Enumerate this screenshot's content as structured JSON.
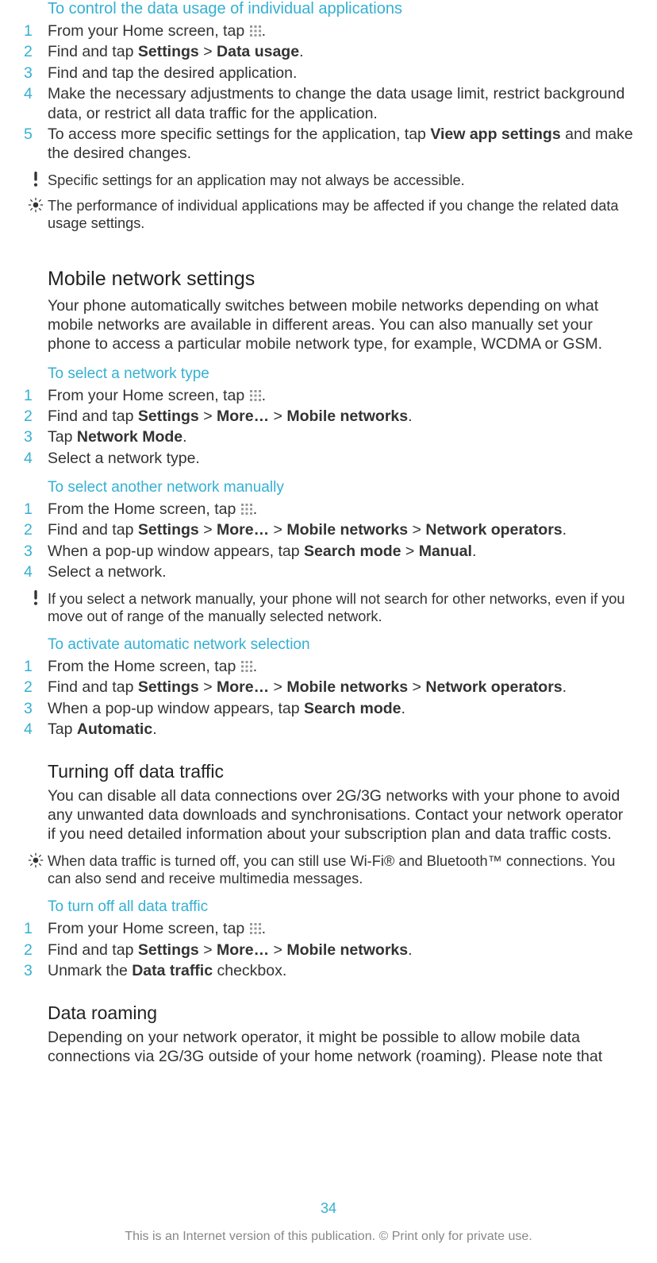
{
  "section1": {
    "heading": "To control the data usage of individual applications",
    "steps": [
      {
        "num": "1",
        "pre": "From your Home screen, tap ",
        "post": "."
      },
      {
        "num": "2",
        "html": "Find and tap <b>Settings</b> > <b>Data usage</b>."
      },
      {
        "num": "3",
        "html": "Find and tap the desired application."
      },
      {
        "num": "4",
        "html": "Make the necessary adjustments to change the data usage limit, restrict background data, or restrict all data traffic for the application."
      },
      {
        "num": "5",
        "html": "To access more specific settings for the application, tap <b>View app settings</b> and make the desired changes."
      }
    ],
    "note_excl": "Specific settings for an application may not always be accessible.",
    "note_bulb": "The performance of individual applications may be affected if you change the related data usage settings."
  },
  "mobilenet": {
    "heading": "Mobile network settings",
    "para": "Your phone automatically switches between mobile networks depending on what mobile networks are available in different areas. You can also manually set your phone to access a particular mobile network type, for example, WCDMA or GSM."
  },
  "selecttype": {
    "heading": "To select a network type",
    "steps": [
      {
        "num": "1",
        "pre": "From your Home screen, tap ",
        "post": "."
      },
      {
        "num": "2",
        "html": "Find and tap <b>Settings</b> > <b>More…</b> > <b>Mobile networks</b>."
      },
      {
        "num": "3",
        "html": "Tap <b>Network Mode</b>."
      },
      {
        "num": "4",
        "html": "Select a network type."
      }
    ]
  },
  "selectmanual": {
    "heading": "To select another network manually",
    "steps": [
      {
        "num": "1",
        "pre": "From the Home screen, tap ",
        "post": "."
      },
      {
        "num": "2",
        "html": "Find and tap <b>Settings</b> > <b>More…</b> > <b>Mobile networks</b> > <b>Network operators</b>."
      },
      {
        "num": "3",
        "html": "When a pop-up window appears, tap <b>Search mode</b> > <b>Manual</b>."
      },
      {
        "num": "4",
        "html": "Select a network."
      }
    ],
    "note_excl": "If you select a network manually, your phone will not search for other networks, even if you move out of range of the manually selected network."
  },
  "autosel": {
    "heading": "To activate automatic network selection",
    "steps": [
      {
        "num": "1",
        "pre": "From the Home screen, tap ",
        "post": "."
      },
      {
        "num": "2",
        "html": "Find and tap <b>Settings</b> > <b>More…</b> > <b>Mobile networks</b> > <b>Network operators</b>."
      },
      {
        "num": "3",
        "html": "When a pop-up window appears, tap <b>Search mode</b>."
      },
      {
        "num": "4",
        "html": "Tap <b>Automatic</b>."
      }
    ]
  },
  "turnoff": {
    "heading": "Turning off data traffic",
    "para": "You can disable all data connections over 2G/3G networks with your phone to avoid any unwanted data downloads and synchronisations. Contact your network operator if you need detailed information about your subscription plan and data traffic costs.",
    "note_bulb": "When data traffic is turned off, you can still use Wi-Fi® and Bluetooth™ connections. You can also send and receive multimedia messages."
  },
  "turnoffsteps": {
    "heading": "To turn off all data traffic",
    "steps": [
      {
        "num": "1",
        "pre": "From your Home screen, tap ",
        "post": "."
      },
      {
        "num": "2",
        "html": "Find and tap <b>Settings</b> > <b>More…</b> > <b>Mobile networks</b>."
      },
      {
        "num": "3",
        "html": "Unmark the <b>Data traffic</b> checkbox."
      }
    ]
  },
  "roaming": {
    "heading": "Data roaming",
    "para": "Depending on your network operator, it might be possible to allow mobile data connections via 2G/3G outside of your home network (roaming). Please note that"
  },
  "page_number": "34",
  "footer": "This is an Internet version of this publication. © Print only for private use."
}
